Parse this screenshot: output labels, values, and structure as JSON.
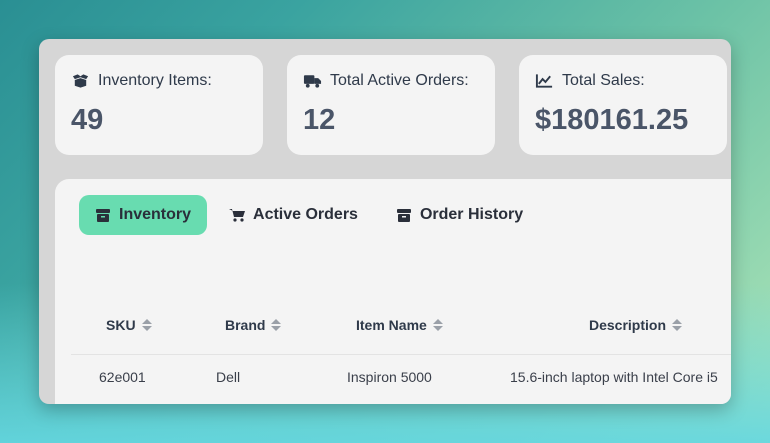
{
  "stats": {
    "inventory": {
      "label": "Inventory Items:",
      "value": "49",
      "icon": "boxes-icon"
    },
    "orders": {
      "label": "Total Active Orders:",
      "value": "12",
      "icon": "truck-icon"
    },
    "sales": {
      "label": "Total Sales:",
      "value": "$180161.25",
      "icon": "chart-line-icon"
    }
  },
  "tabs": [
    {
      "label": "Inventory",
      "icon": "box-icon",
      "active": true
    },
    {
      "label": "Active Orders",
      "icon": "cart-icon",
      "active": false
    },
    {
      "label": "Order History",
      "icon": "archive-icon",
      "active": false
    }
  ],
  "table": {
    "columns": [
      "SKU",
      "Brand",
      "Item Name",
      "Description"
    ],
    "rows": [
      [
        "62e001",
        "Dell",
        "Inspiron 5000",
        "15.6-inch laptop with Intel Core i5"
      ]
    ]
  },
  "colors": {
    "active_tab": "#68dcb0",
    "value_text": "#4a5568"
  }
}
